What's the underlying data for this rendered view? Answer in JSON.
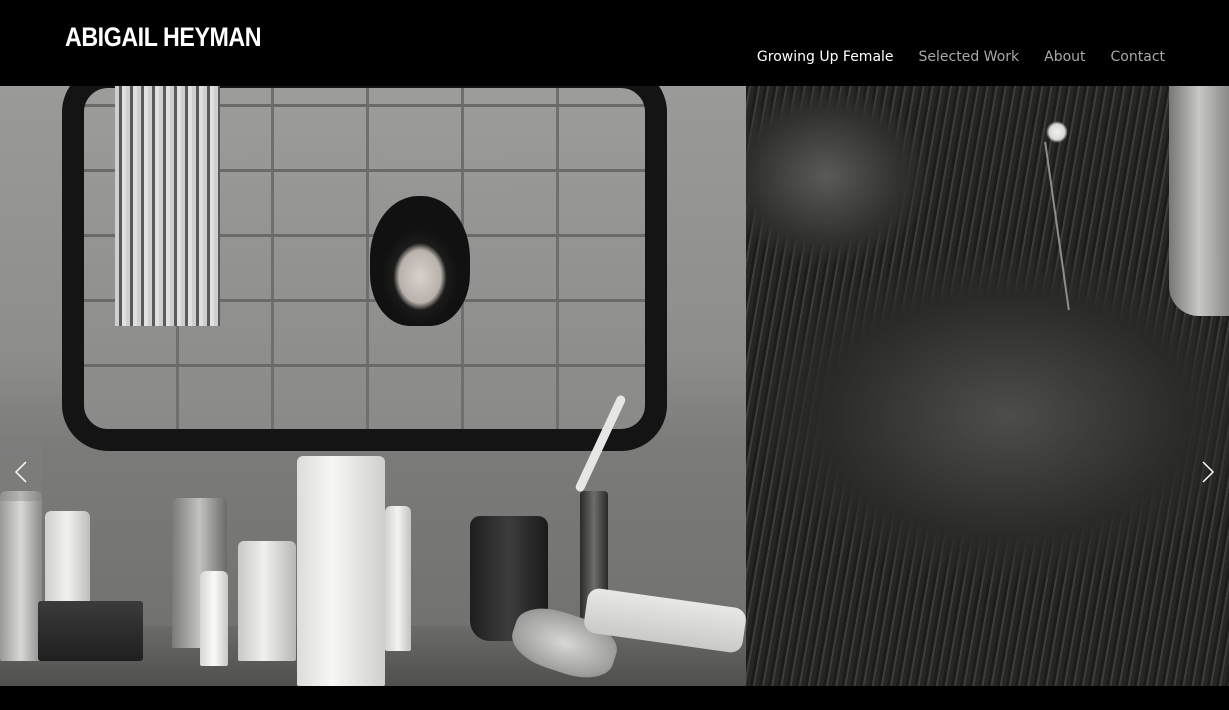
{
  "header": {
    "logo_text": "ABIGAIL HEYMAN"
  },
  "nav": {
    "items": [
      {
        "label": "Growing Up Female",
        "active": true
      },
      {
        "label": "Selected Work",
        "active": false
      },
      {
        "label": "About",
        "active": false
      },
      {
        "label": "Contact",
        "active": false
      }
    ]
  },
  "slideshow": {
    "prev_icon": "chevron-left-icon",
    "next_icon": "chevron-right-icon"
  },
  "colors": {
    "background": "#000000",
    "nav_active": "#ffffff",
    "nav_inactive": "#a9a9a9"
  }
}
